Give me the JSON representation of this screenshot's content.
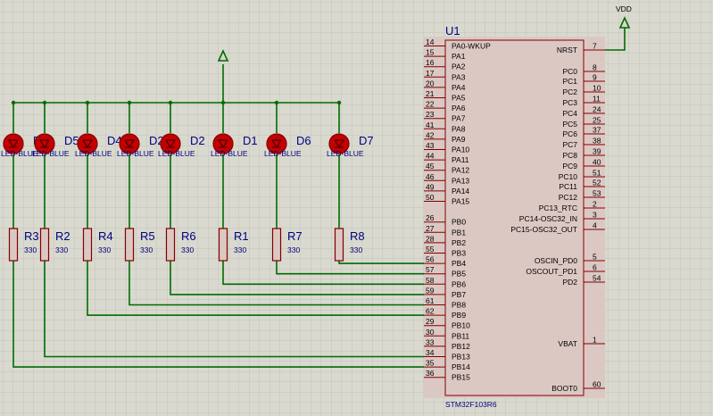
{
  "colors": {
    "background": "#d9d9cf",
    "grid": "#c3c3b8",
    "wire": "#006b00",
    "component": "#800000",
    "chip_fill": "#dcc8c3",
    "led_fill": "#c40000",
    "text": "#000080",
    "small_text": "#000000"
  },
  "power": {
    "vdd_label": "VDD"
  },
  "chip": {
    "ref": "U1",
    "part": "STM32F103R6",
    "left_pins": [
      {
        "num": "14",
        "name": "PA0-WKUP"
      },
      {
        "num": "15",
        "name": "PA1"
      },
      {
        "num": "16",
        "name": "PA2"
      },
      {
        "num": "17",
        "name": "PA3"
      },
      {
        "num": "20",
        "name": "PA4"
      },
      {
        "num": "21",
        "name": "PA5"
      },
      {
        "num": "22",
        "name": "PA6"
      },
      {
        "num": "23",
        "name": "PA7"
      },
      {
        "num": "41",
        "name": "PA8"
      },
      {
        "num": "42",
        "name": "PA9"
      },
      {
        "num": "43",
        "name": "PA10"
      },
      {
        "num": "44",
        "name": "PA11"
      },
      {
        "num": "45",
        "name": "PA12"
      },
      {
        "num": "46",
        "name": "PA13"
      },
      {
        "num": "49",
        "name": "PA14"
      },
      {
        "num": "50",
        "name": "PA15"
      },
      {
        "num": "26",
        "name": "PB0"
      },
      {
        "num": "27",
        "name": "PB1"
      },
      {
        "num": "28",
        "name": "PB2"
      },
      {
        "num": "55",
        "name": "PB3"
      },
      {
        "num": "56",
        "name": "PB4"
      },
      {
        "num": "57",
        "name": "PB5"
      },
      {
        "num": "58",
        "name": "PB6"
      },
      {
        "num": "59",
        "name": "PB7"
      },
      {
        "num": "61",
        "name": "PB8"
      },
      {
        "num": "62",
        "name": "PB9"
      },
      {
        "num": "29",
        "name": "PB10"
      },
      {
        "num": "30",
        "name": "PB11"
      },
      {
        "num": "33",
        "name": "PB12"
      },
      {
        "num": "34",
        "name": "PB13"
      },
      {
        "num": "35",
        "name": "PB14"
      },
      {
        "num": "36",
        "name": "PB15"
      }
    ],
    "right_pins": [
      {
        "num": "7",
        "name": "NRST"
      },
      {
        "num": "8",
        "name": "PC0"
      },
      {
        "num": "9",
        "name": "PC1"
      },
      {
        "num": "10",
        "name": "PC2"
      },
      {
        "num": "11",
        "name": "PC3"
      },
      {
        "num": "24",
        "name": "PC4"
      },
      {
        "num": "25",
        "name": "PC5"
      },
      {
        "num": "37",
        "name": "PC6"
      },
      {
        "num": "38",
        "name": "PC7"
      },
      {
        "num": "39",
        "name": "PC8"
      },
      {
        "num": "40",
        "name": "PC9"
      },
      {
        "num": "51",
        "name": "PC10"
      },
      {
        "num": "52",
        "name": "PC11"
      },
      {
        "num": "53",
        "name": "PC12"
      },
      {
        "num": "2",
        "name": "PC13_RTC"
      },
      {
        "num": "3",
        "name": "PC14-OSC32_IN"
      },
      {
        "num": "4",
        "name": "PC15-OSC32_OUT"
      },
      {
        "num": "5",
        "name": "OSCIN_PD0"
      },
      {
        "num": "6",
        "name": "OSCOUT_PD1"
      },
      {
        "num": "54",
        "name": "PD2"
      },
      {
        "num": "1",
        "name": "VBAT"
      },
      {
        "num": "60",
        "name": "BOOT0"
      }
    ]
  },
  "leds": [
    {
      "ref": "D3",
      "value": "LED-BLUE"
    },
    {
      "ref": "D5",
      "value": "LED-BLUE"
    },
    {
      "ref": "D4",
      "value": "LED-BLUE"
    },
    {
      "ref": "D2",
      "value": "LED-BLUE"
    },
    {
      "ref": "D2",
      "value": "LED-BLUE"
    },
    {
      "ref": "D1",
      "value": "LED-BLUE"
    },
    {
      "ref": "D6",
      "value": "LED-BLUE"
    },
    {
      "ref": "D7",
      "value": "LED-BLUE"
    }
  ],
  "resistors": [
    {
      "ref": "R3",
      "value": "330"
    },
    {
      "ref": "R2",
      "value": "330"
    },
    {
      "ref": "R4",
      "value": "330"
    },
    {
      "ref": "R5",
      "value": "330"
    },
    {
      "ref": "R6",
      "value": "330"
    },
    {
      "ref": "R1",
      "value": "330"
    },
    {
      "ref": "R7",
      "value": "330"
    },
    {
      "ref": "R8",
      "value": "330"
    }
  ]
}
